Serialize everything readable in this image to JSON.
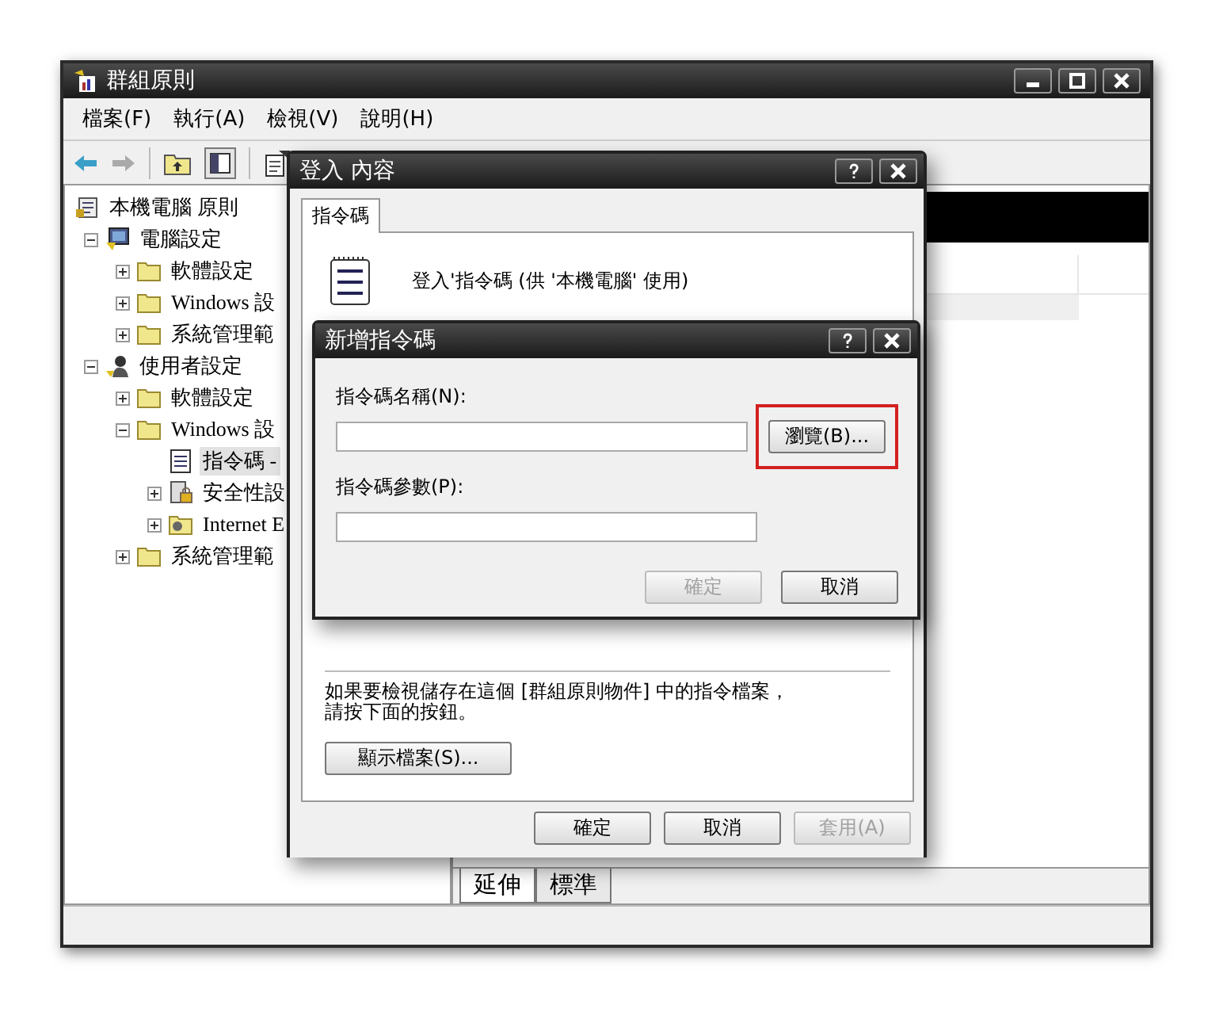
{
  "window": {
    "title": "群組原則"
  },
  "menu": [
    "檔案(F)",
    "執行(A)",
    "檢視(V)",
    "說明(H)"
  ],
  "tree": [
    {
      "label": "本機電腦 原則",
      "kind": "policy",
      "selected": false,
      "children": [
        {
          "label": "電腦設定",
          "kind": "computer",
          "expanded": true,
          "selected": false,
          "children": [
            {
              "label": "軟體設定",
              "kind": "folder",
              "expanded": false,
              "selected": false
            },
            {
              "label": "Windows 設",
              "kind": "folder",
              "expanded": false,
              "selected": false
            },
            {
              "label": "系統管理範",
              "kind": "folder",
              "expanded": false,
              "selected": false
            }
          ]
        },
        {
          "label": "使用者設定",
          "kind": "user",
          "expanded": true,
          "selected": false,
          "children": [
            {
              "label": "軟體設定",
              "kind": "folder",
              "expanded": false,
              "selected": false
            },
            {
              "label": "Windows 設",
              "kind": "folder",
              "expanded": true,
              "selected": false,
              "children": [
                {
                  "label": "指令碼 -",
                  "kind": "script",
                  "selected": true
                },
                {
                  "label": "安全性設",
                  "kind": "security",
                  "expanded": false,
                  "selected": false
                },
                {
                  "label": "Internet E",
                  "kind": "internet",
                  "expanded": false,
                  "selected": false
                }
              ]
            },
            {
              "label": "系統管理範",
              "kind": "folder",
              "expanded": false,
              "selected": false
            }
          ]
        }
      ]
    }
  ],
  "bottom_tabs": [
    {
      "label": "延伸",
      "selected": true
    },
    {
      "label": "標準",
      "selected": false
    }
  ],
  "properties_dialog": {
    "title": "登入 內容",
    "tabs": [
      {
        "label": "指令碼",
        "selected": true
      }
    ],
    "heading": "登入'指令碼 (供 '本機電腦' 使用)",
    "note_lines": [
      "如果要檢視儲存在這個 [群組原則物件] 中的指令檔案，",
      "請按下面的按鈕。"
    ],
    "show_files_button": "顯示檔案(S)...",
    "buttons": [
      {
        "label": "確定",
        "disabled": false
      },
      {
        "label": "取消",
        "disabled": false
      },
      {
        "label": "套用(A)",
        "disabled": true
      }
    ]
  },
  "add_script_dialog": {
    "title": "新增指令碼",
    "fields": [
      {
        "label": "指令碼名稱(N):"
      },
      {
        "label": "指令碼參數(P):"
      }
    ],
    "browse_button": {
      "label": "瀏覽(B)...",
      "highlighted": true
    },
    "buttons": [
      {
        "label": "確定",
        "disabled": true
      },
      {
        "label": "取消",
        "disabled": false
      }
    ]
  }
}
